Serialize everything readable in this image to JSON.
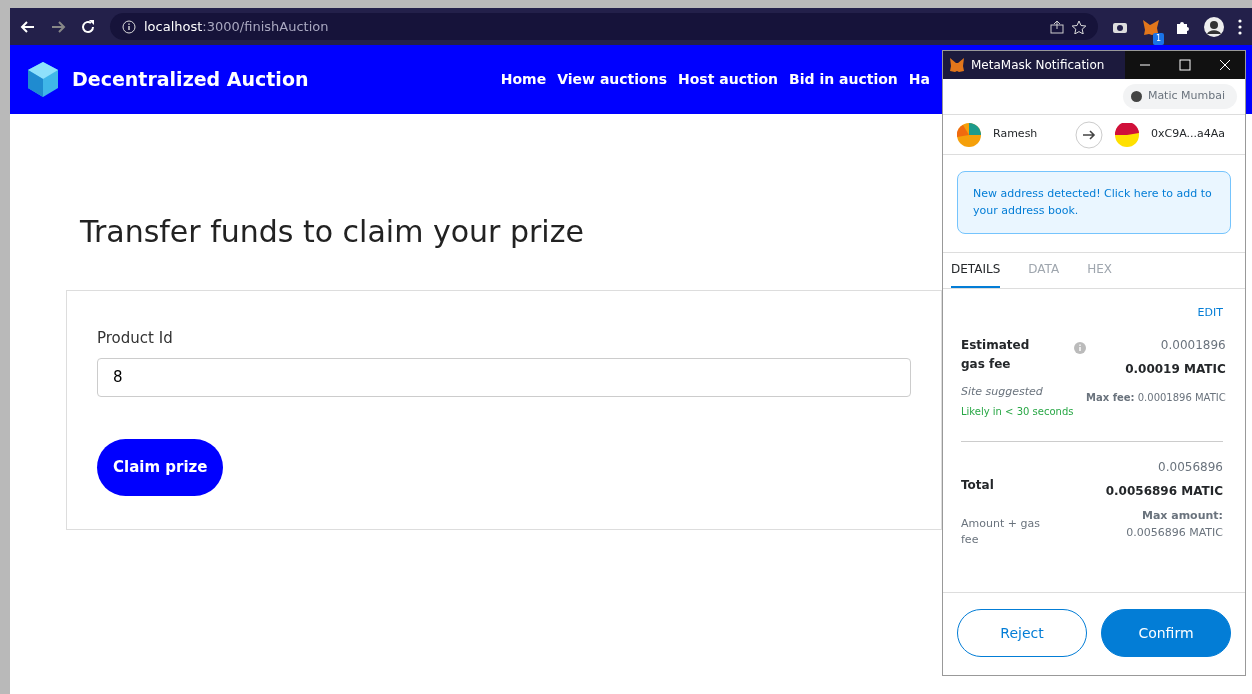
{
  "browser": {
    "url_host": "localhost",
    "url_path": ":3000/finishAuction",
    "extension_badge": "1"
  },
  "navbar": {
    "brand": "Decentralized Auction",
    "links": [
      {
        "label": "Home"
      },
      {
        "label": "View auctions"
      },
      {
        "label": "Host auction"
      },
      {
        "label": "Bid in auction"
      },
      {
        "label": "Ha"
      }
    ]
  },
  "page": {
    "heading": "Transfer funds to claim your prize",
    "field": {
      "label": "Product Id",
      "value": "8"
    },
    "button": "Claim prize"
  },
  "metamask": {
    "title": "MetaMask Notification",
    "network": "Matic Mumbai",
    "from": "Ramesh",
    "to": "0xC9A...a4Aa",
    "alert": "New address detected! Click here to add to your address book.",
    "tabs": [
      {
        "label": "DETAILS",
        "selected": true
      },
      {
        "label": "DATA",
        "selected": false
      },
      {
        "label": "HEX",
        "selected": false
      }
    ],
    "edit": "EDIT",
    "gas": {
      "label": "Estimated gas fee",
      "amount": "0.0001896",
      "amount_bold": "0.00019 MATIC",
      "note": "Site suggested",
      "likely": "Likely in < 30 seconds",
      "max_label": "Max fee:",
      "max_value": "0.0001896 MATIC"
    },
    "total": {
      "label": "Total",
      "amount": "0.0056896",
      "amount_bold": "0.0056896 MATIC",
      "note": "Amount + gas fee",
      "max_label": "Max amount:",
      "max_value": "0.0056896 MATIC"
    },
    "buttons": [
      {
        "label": "Reject",
        "kind": "outline"
      },
      {
        "label": "Confirm",
        "kind": "primary"
      }
    ]
  }
}
